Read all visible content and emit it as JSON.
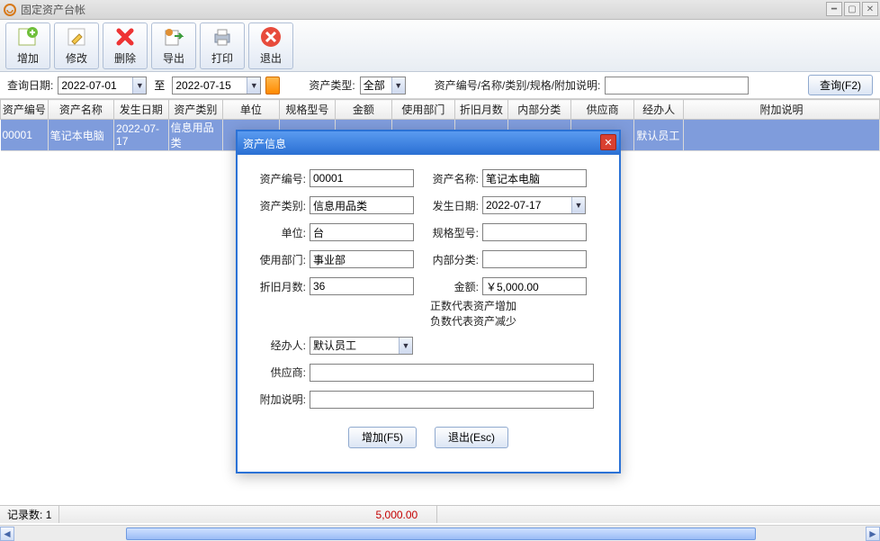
{
  "window": {
    "title": "固定资产台帐"
  },
  "toolbar": {
    "add": "增加",
    "edit": "修改",
    "delete": "删除",
    "export": "导出",
    "print": "打印",
    "exit": "退出"
  },
  "filter": {
    "date_label": "查询日期:",
    "date_from": "2022-07-01",
    "to": "至",
    "date_to": "2022-07-15",
    "type_label": "资产类型:",
    "type_value": "全部",
    "search_label": "资产编号/名称/类别/规格/附加说明:",
    "search_value": "",
    "query_btn": "查询(F2)"
  },
  "columns": [
    "资产编号",
    "资产名称",
    "发生日期",
    "资产类别",
    "单位",
    "规格型号",
    "金额",
    "使用部门",
    "折旧月数",
    "内部分类",
    "供应商",
    "经办人",
    "附加说明"
  ],
  "rows": [
    {
      "c0": "00001",
      "c1": "笔记本电脑",
      "c2": "2022-07-17",
      "c3": "信息用品类",
      "c4": "",
      "c5": "",
      "c6": "",
      "c7": "",
      "c8": "",
      "c9": "",
      "c10": "",
      "c11": "默认员工",
      "c12": ""
    }
  ],
  "status": {
    "record_label": "记录数:",
    "record_count": "1",
    "amount": "5,000.00"
  },
  "modal": {
    "title": "资产信息",
    "asset_no_label": "资产编号:",
    "asset_no": "00001",
    "asset_name_label": "资产名称:",
    "asset_name": "笔记本电脑",
    "category_label": "资产类别:",
    "category": "信息用品类",
    "occur_date_label": "发生日期:",
    "occur_date": "2022-07-17",
    "unit_label": "单位:",
    "unit": "台",
    "spec_label": "规格型号:",
    "spec": "",
    "dept_label": "使用部门:",
    "dept": "事业部",
    "subcat_label": "内部分类:",
    "subcat": "",
    "dep_month_label": "折旧月数:",
    "dep_month": "36",
    "amount_label": "金额:",
    "amount": "￥5,000.00",
    "note_line1": "正数代表资产增加",
    "note_line2": "负数代表资产减少",
    "handler_label": "经办人:",
    "handler": "默认员工",
    "supplier_label": "供应商:",
    "supplier": "",
    "remark_label": "附加说明:",
    "remark": "",
    "btn_add": "增加(F5)",
    "btn_exit": "退出(Esc)"
  }
}
